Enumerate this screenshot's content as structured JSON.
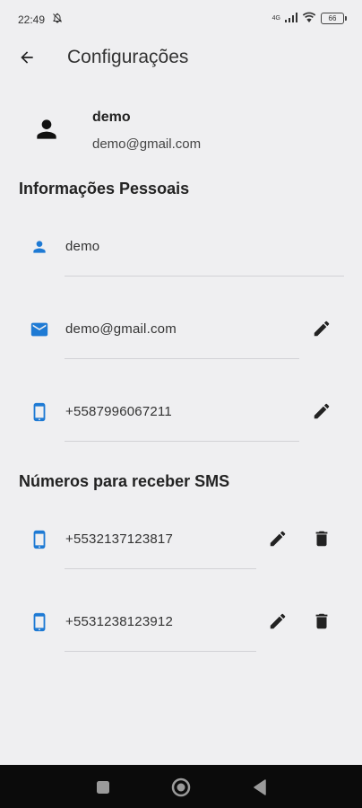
{
  "status_bar": {
    "time": "22:49",
    "network": "4G",
    "battery": "66"
  },
  "app_bar": {
    "title": "Configurações"
  },
  "profile": {
    "name": "demo",
    "email": "demo@gmail.com"
  },
  "personal_info": {
    "title": "Informações Pessoais",
    "name": "demo",
    "email": "demo@gmail.com",
    "phone": "+5587996067211"
  },
  "sms_numbers": {
    "title": "Números para receber SMS",
    "items": [
      "+5532137123817",
      "+5531238123912"
    ]
  },
  "colors": {
    "accent": "#1e7ad4",
    "background": "#efeff1",
    "icon": "#222222"
  }
}
